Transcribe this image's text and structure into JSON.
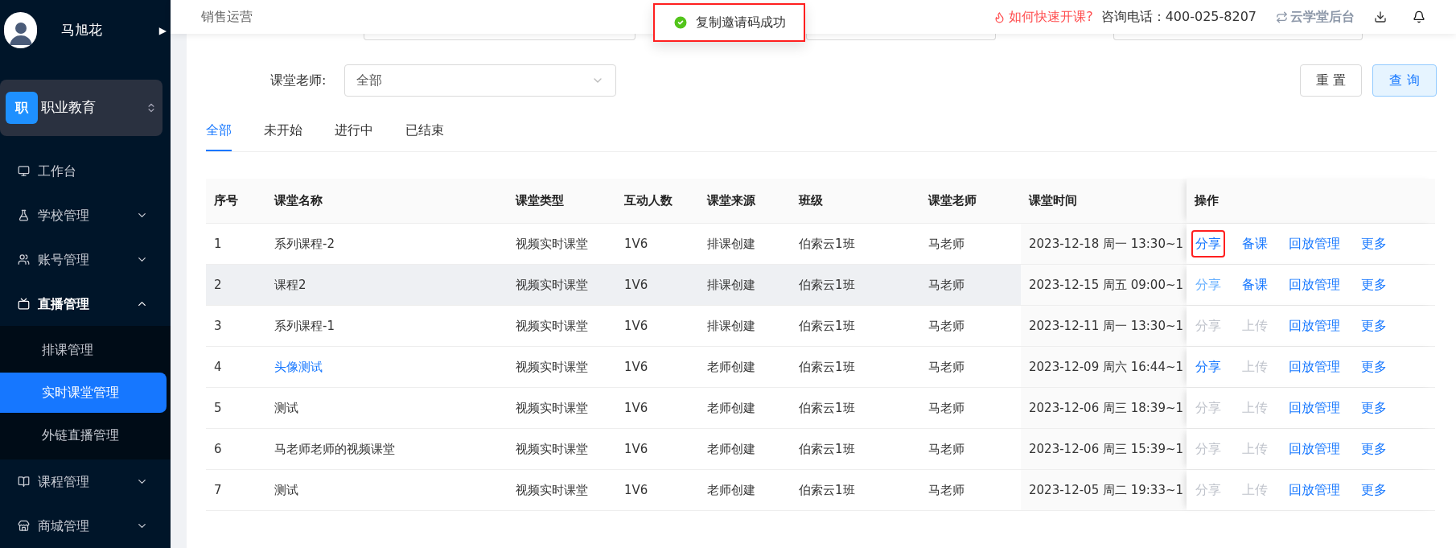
{
  "sidebar": {
    "user": {
      "name": "马旭花",
      "expand_glyph": "▶"
    },
    "org": {
      "badge": "职",
      "name": "职业教育"
    },
    "menu": [
      {
        "label": "工作台",
        "expanded": false,
        "has_arrow": false
      },
      {
        "label": "学校管理",
        "expanded": false,
        "has_arrow": true
      },
      {
        "label": "账号管理",
        "expanded": false,
        "has_arrow": true
      },
      {
        "label": "直播管理",
        "expanded": true,
        "has_arrow": true,
        "children": [
          {
            "label": "排课管理",
            "selected": false
          },
          {
            "label": "实时课堂管理",
            "selected": true
          },
          {
            "label": "外链直播管理",
            "selected": false
          }
        ]
      },
      {
        "label": "课程管理",
        "expanded": false,
        "has_arrow": true
      },
      {
        "label": "商城管理",
        "expanded": false,
        "has_arrow": true
      }
    ]
  },
  "header": {
    "breadcrumb": "销售运营",
    "help_link": "如何快速开课?",
    "phone": "咨询电话：400-025-8207",
    "backend_link": "云学堂后台"
  },
  "toast": {
    "message": "复制邀请码成功",
    "annotated": true
  },
  "filters": {
    "teacher_label": "课堂老师:",
    "teacher_value": "全部",
    "reset": "重 置",
    "search": "查 询"
  },
  "tabs": [
    {
      "label": "全部",
      "selected": true
    },
    {
      "label": "未开始",
      "selected": false
    },
    {
      "label": "进行中",
      "selected": false
    },
    {
      "label": "已结束",
      "selected": false
    }
  ],
  "table": {
    "columns": [
      "序号",
      "课堂名称",
      "课堂类型",
      "互动人数",
      "课堂来源",
      "班级",
      "课堂老师",
      "课堂时间",
      "操作"
    ],
    "rows": [
      {
        "cells": [
          "1",
          "系列课程-2",
          "视频实时课堂",
          "1V6",
          "排课创建",
          "伯索云1班",
          "马老师",
          "2023-12-18 周一 13:30~1"
        ],
        "name_link": false,
        "hovered": false,
        "actions": [
          {
            "label": "分享",
            "disabled": false,
            "hovered": false,
            "annotated": true
          },
          {
            "label": "备课",
            "disabled": false,
            "hovered": false,
            "annotated": false
          },
          {
            "label": "回放管理",
            "disabled": false,
            "hovered": false,
            "annotated": false
          },
          {
            "label": "更多",
            "disabled": false,
            "hovered": false,
            "annotated": false
          }
        ]
      },
      {
        "cells": [
          "2",
          "课程2",
          "视频实时课堂",
          "1V6",
          "排课创建",
          "伯索云1班",
          "马老师",
          "2023-12-15 周五 09:00~1"
        ],
        "name_link": false,
        "hovered": true,
        "actions": [
          {
            "label": "分享",
            "disabled": false,
            "hovered": true,
            "annotated": false
          },
          {
            "label": "备课",
            "disabled": false,
            "hovered": false,
            "annotated": false
          },
          {
            "label": "回放管理",
            "disabled": false,
            "hovered": false,
            "annotated": false
          },
          {
            "label": "更多",
            "disabled": false,
            "hovered": false,
            "annotated": false
          }
        ]
      },
      {
        "cells": [
          "3",
          "系列课程-1",
          "视频实时课堂",
          "1V6",
          "排课创建",
          "伯索云1班",
          "马老师",
          "2023-12-11 周一 13:30~1"
        ],
        "name_link": false,
        "hovered": false,
        "actions": [
          {
            "label": "分享",
            "disabled": true,
            "hovered": false,
            "annotated": false
          },
          {
            "label": "上传",
            "disabled": true,
            "hovered": false,
            "annotated": false
          },
          {
            "label": "回放管理",
            "disabled": false,
            "hovered": false,
            "annotated": false
          },
          {
            "label": "更多",
            "disabled": false,
            "hovered": false,
            "annotated": false
          }
        ]
      },
      {
        "cells": [
          "4",
          "头像测试",
          "视频实时课堂",
          "1V6",
          "老师创建",
          "伯索云1班",
          "马老师",
          "2023-12-09 周六 16:44~1"
        ],
        "name_link": true,
        "hovered": false,
        "actions": [
          {
            "label": "分享",
            "disabled": false,
            "hovered": false,
            "annotated": false
          },
          {
            "label": "上传",
            "disabled": true,
            "hovered": false,
            "annotated": false
          },
          {
            "label": "回放管理",
            "disabled": false,
            "hovered": false,
            "annotated": false
          },
          {
            "label": "更多",
            "disabled": false,
            "hovered": false,
            "annotated": false
          }
        ]
      },
      {
        "cells": [
          "5",
          "测试",
          "视频实时课堂",
          "1V6",
          "老师创建",
          "伯索云1班",
          "马老师",
          "2023-12-06 周三 18:39~1"
        ],
        "name_link": false,
        "hovered": false,
        "actions": [
          {
            "label": "分享",
            "disabled": true,
            "hovered": false,
            "annotated": false
          },
          {
            "label": "上传",
            "disabled": true,
            "hovered": false,
            "annotated": false
          },
          {
            "label": "回放管理",
            "disabled": false,
            "hovered": false,
            "annotated": false
          },
          {
            "label": "更多",
            "disabled": false,
            "hovered": false,
            "annotated": false
          }
        ]
      },
      {
        "cells": [
          "6",
          "马老师老师的视频课堂",
          "视频实时课堂",
          "1V6",
          "老师创建",
          "伯索云1班",
          "马老师",
          "2023-12-06 周三 15:39~1"
        ],
        "name_link": false,
        "hovered": false,
        "actions": [
          {
            "label": "分享",
            "disabled": true,
            "hovered": false,
            "annotated": false
          },
          {
            "label": "上传",
            "disabled": true,
            "hovered": false,
            "annotated": false
          },
          {
            "label": "回放管理",
            "disabled": false,
            "hovered": false,
            "annotated": false
          },
          {
            "label": "更多",
            "disabled": false,
            "hovered": false,
            "annotated": false
          }
        ]
      },
      {
        "cells": [
          "7",
          "测试",
          "视频实时课堂",
          "1V6",
          "老师创建",
          "伯索云1班",
          "马老师",
          "2023-12-05 周二 19:33~1"
        ],
        "name_link": false,
        "hovered": false,
        "actions": [
          {
            "label": "分享",
            "disabled": true,
            "hovered": false,
            "annotated": false
          },
          {
            "label": "上传",
            "disabled": true,
            "hovered": false,
            "annotated": false
          },
          {
            "label": "回放管理",
            "disabled": false,
            "hovered": false,
            "annotated": false
          },
          {
            "label": "更多",
            "disabled": false,
            "hovered": false,
            "annotated": false
          }
        ]
      }
    ]
  }
}
